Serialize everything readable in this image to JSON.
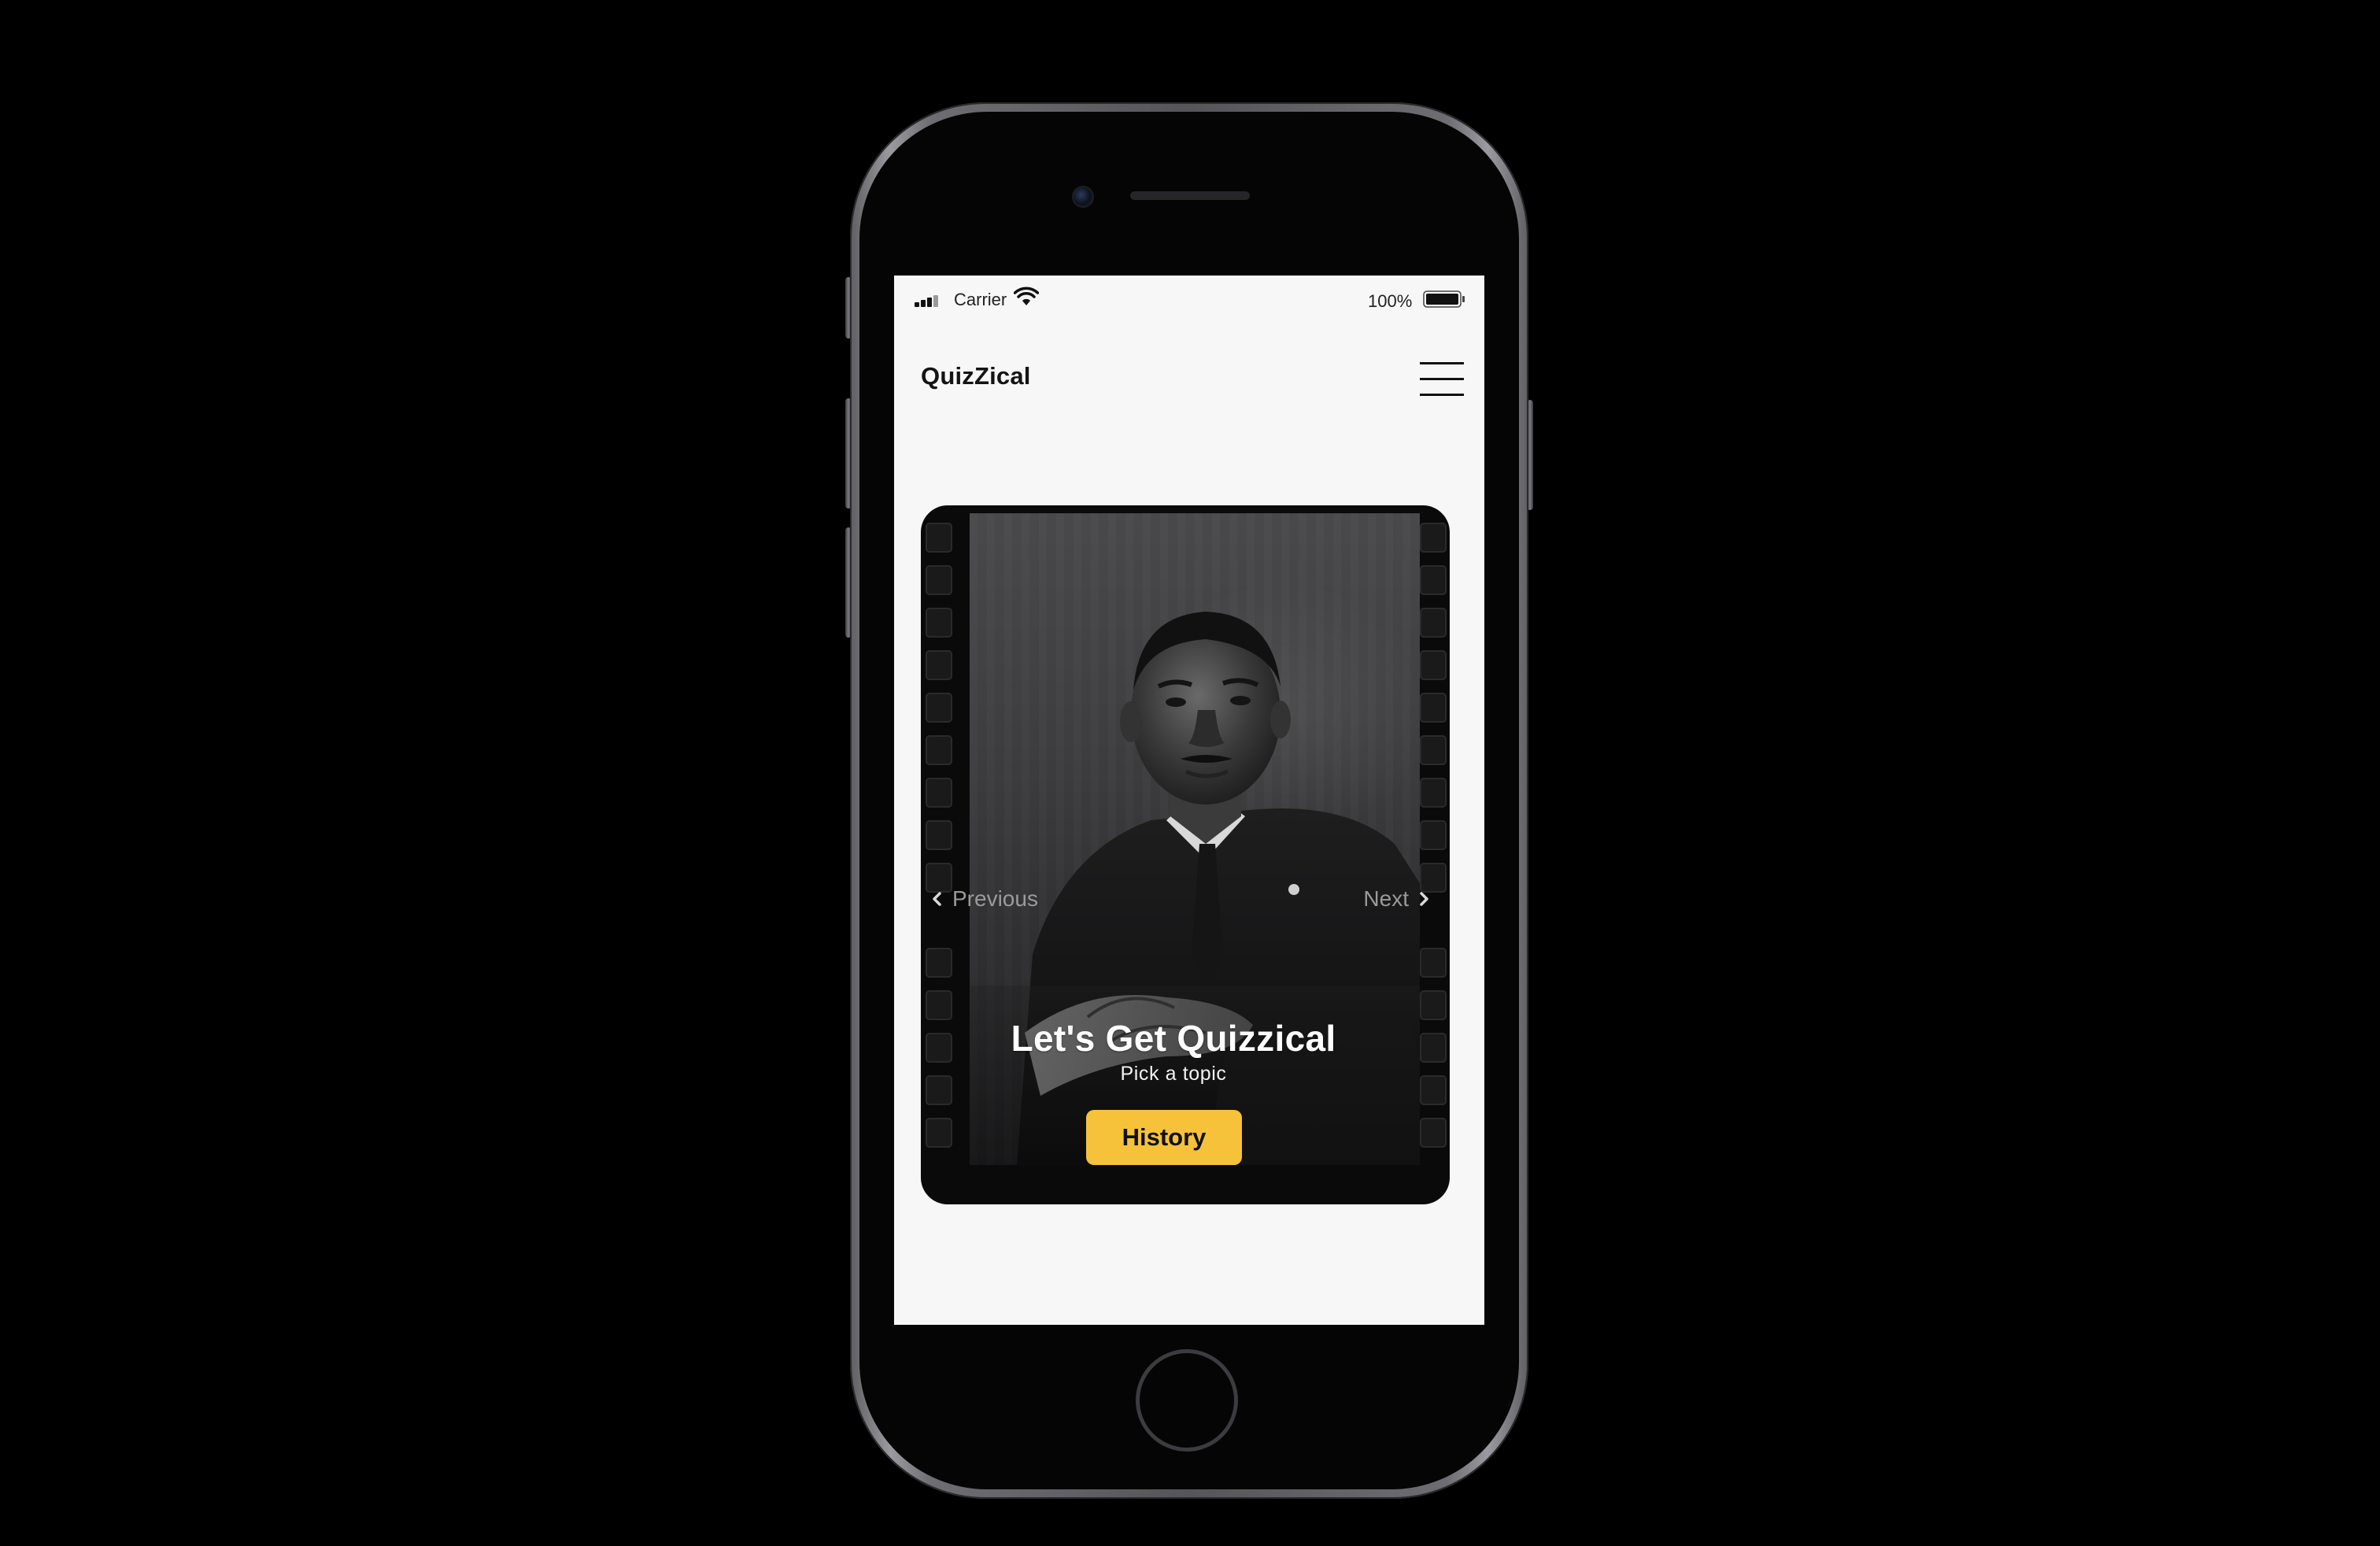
{
  "status_bar": {
    "carrier": "Carrier",
    "battery_percent": "100%"
  },
  "header": {
    "app_title": "QuizZical",
    "menu_icon": "hamburger-menu-icon"
  },
  "card": {
    "prev_label": "Previous",
    "next_label": "Next",
    "headline": "Let's Get Quizzical",
    "subline": "Pick a topic",
    "topic_button_label": "History",
    "image": "black-and-white portrait photo on film strip",
    "accent_color": "#f5c23a"
  },
  "colors": {
    "background": "#000000",
    "screen": "#f7f7f8",
    "accent": "#f5c23a"
  }
}
